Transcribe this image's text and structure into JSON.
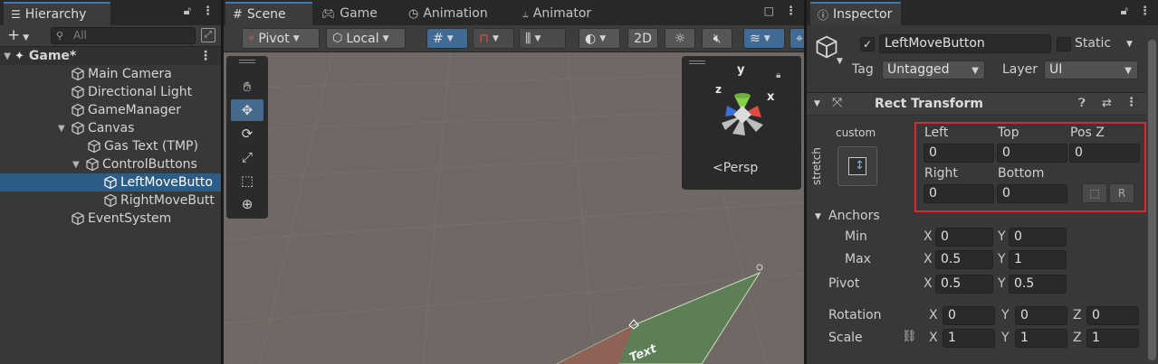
{
  "hierarchy": {
    "tab_label": "Hierarchy",
    "search_placeholder": "All",
    "add_symbol": "+",
    "items": [
      {
        "label": "Game*"
      },
      {
        "label": "Main Camera"
      },
      {
        "label": "Directional Light"
      },
      {
        "label": "GameManager"
      },
      {
        "label": "Canvas"
      },
      {
        "label": "Gas Text (TMP)"
      },
      {
        "label": "ControlButtons"
      },
      {
        "label": "LeftMoveButto"
      },
      {
        "label": "RightMoveButt"
      },
      {
        "label": "EventSystem"
      }
    ]
  },
  "scene": {
    "tabs": [
      {
        "label": "Scene"
      },
      {
        "label": "Game"
      },
      {
        "label": "Animation"
      },
      {
        "label": "Animator"
      }
    ],
    "toolbar": {
      "pivot_label": "Pivot",
      "local_label": "Local",
      "mode_2d_label": "2D"
    },
    "gizmo": {
      "persp_label": "Persp",
      "axis_x": "x",
      "axis_y": "y",
      "axis_z": "z"
    },
    "canvas_text": "Text"
  },
  "inspector": {
    "tab_label": "Inspector",
    "object_name": "LeftMoveButton",
    "active_checked": true,
    "static_label": "Static",
    "tag_label": "Tag",
    "tag_value": "Untagged",
    "layer_label": "Layer",
    "layer_value": "UI",
    "component_title": "Rect Transform",
    "anchor_preset": {
      "horizontal": "custom",
      "vertical": "stretch"
    },
    "fields": {
      "left_label": "Left",
      "left_value": "0",
      "top_label": "Top",
      "top_value": "0",
      "posz_label": "Pos Z",
      "posz_value": "0",
      "right_label": "Right",
      "right_value": "0",
      "bottom_label": "Bottom",
      "bottom_value": "0"
    },
    "anchors": {
      "label": "Anchors",
      "min_label": "Min",
      "min_x": "0",
      "min_y": "0",
      "max_label": "Max",
      "max_x": "0.5",
      "max_y": "1"
    },
    "pivot": {
      "label": "Pivot",
      "x": "0.5",
      "y": "0.5"
    },
    "rotation": {
      "label": "Rotation",
      "x": "0",
      "y": "0",
      "z": "0"
    },
    "scale": {
      "label": "Scale",
      "x": "1",
      "y": "1",
      "z": "1"
    },
    "axis_labels": {
      "x": "X",
      "y": "Y",
      "z": "Z"
    },
    "colors": {
      "highlight_box": "#e0252b",
      "selection": "#2c5d87",
      "accent": "#3a79bb"
    }
  }
}
